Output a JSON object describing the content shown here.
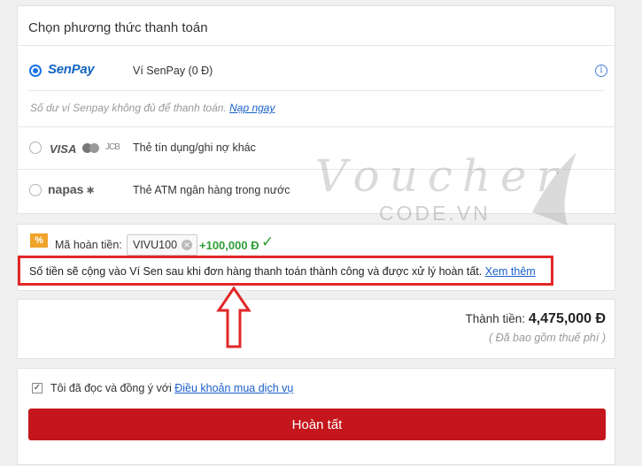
{
  "payment": {
    "title": "Chọn phương thức thanh toán",
    "methods": [
      {
        "logo": "SenPay",
        "label": "Ví SenPay (0 Đ)",
        "selected": true,
        "icon": "info-icon"
      },
      {
        "logo": "VISA",
        "label": "Thẻ tín dụng/ghi nợ khác",
        "selected": false
      },
      {
        "logo": "napas",
        "label": "Thẻ ATM ngân hàng trong nước",
        "selected": false
      }
    ],
    "note_text": "Số dư ví Senpay không đủ để thanh toán. ",
    "note_link": "Nạp ngay",
    "jcb_text": "JCB"
  },
  "voucher": {
    "icon_text": "%",
    "label": "Mã hoàn tiền:",
    "code": "VIVU100",
    "cashback": "+100,000 Đ",
    "check_icon": "✓",
    "notice_text": "Số tiền sẽ cộng vào Ví Sen sau khi đơn hàng thanh toán thành công và được xử lý hoàn tất. ",
    "notice_link": "Xem thêm"
  },
  "total": {
    "label": "Thành tiền: ",
    "value": "4,475,000 Đ",
    "tax_note": "( Đã bao gồm thuế phí )"
  },
  "agreement": {
    "text": "Tôi đã đọc và đồng ý với ",
    "link": "Điều khoản mua dịch vụ",
    "checked": true
  },
  "submit_label": "Hoàn tất",
  "watermark": {
    "big": "Voucher",
    "small": "CODE.VN"
  },
  "colors": {
    "accent_blue": "#1a73e8",
    "primary_red": "#c4161c",
    "success_green": "#2e9e35",
    "highlight_red": "#e02828"
  }
}
